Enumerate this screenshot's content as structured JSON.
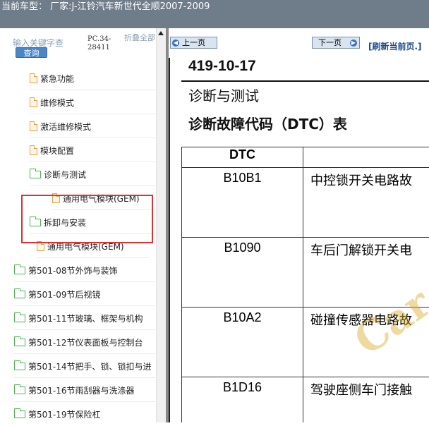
{
  "header": {
    "title": "当前车型： 厂家:J-江铃汽车新世代全顺2007-2009"
  },
  "left": {
    "search_placeholder": "输入关键字查",
    "search_button": "查询",
    "pc_code": "PC.34-28411",
    "collapse_label": "折叠全部",
    "tree": [
      {
        "label": "紧急功能",
        "icon": "doc-icon",
        "level": 2
      },
      {
        "label": "维修模式",
        "icon": "doc-icon",
        "level": 2
      },
      {
        "label": "激活维修模式",
        "icon": "doc-icon",
        "level": 2
      },
      {
        "label": "模块配置",
        "icon": "doc-icon",
        "level": 2
      },
      {
        "label": "诊断与测试",
        "icon": "folder-open-icon",
        "level": 2
      },
      {
        "label": "通用电气模块(GEM)",
        "icon": "doc-icon",
        "level": 3
      },
      {
        "label": "拆卸与安装",
        "icon": "folder-open-icon",
        "level": 2
      },
      {
        "label": "通用电气模块(GEM)",
        "icon": "doc-icon",
        "level": 2
      },
      {
        "label": "第501-08节外饰与装饰",
        "icon": "folder-icon",
        "level": 1
      },
      {
        "label": "第501-09节后视镜",
        "icon": "folder-icon",
        "level": 1
      },
      {
        "label": "第501-11节玻璃、框架与机构",
        "icon": "folder-icon",
        "level": 1
      },
      {
        "label": "第501-12节仪表面板与控制台",
        "icon": "folder-icon",
        "level": 1
      },
      {
        "label": "第501-14节把手、锁、锁扣与进",
        "icon": "folder-icon",
        "level": 1
      },
      {
        "label": "第501-16节雨刮器与洗涤器",
        "icon": "folder-icon",
        "level": 1
      },
      {
        "label": "第501-19节保险杠",
        "icon": "folder-icon",
        "level": 1
      }
    ]
  },
  "nav": {
    "prev": "上一页",
    "next": "下一页",
    "refresh": "[刷新当前页.]"
  },
  "doc": {
    "section_no": "419-10-17",
    "title": "诊断与测试",
    "subtitle": "诊断故障代码（DTC）表",
    "table_header": "DTC",
    "rows": [
      {
        "code": "B10B1",
        "desc": "中控锁开关电路故"
      },
      {
        "code": "B1090",
        "desc": "车后门解锁开关电"
      },
      {
        "code": "B10A2",
        "desc": "碰撞传感器电路故"
      },
      {
        "code": "B1D16",
        "desc": "驾驶座侧车门接触"
      }
    ],
    "watermark": "Car"
  },
  "colors": {
    "titlebar": "#6f7c8a",
    "highlight": "#e03030",
    "folder": "#4caf50",
    "doc": "#e8a040"
  }
}
